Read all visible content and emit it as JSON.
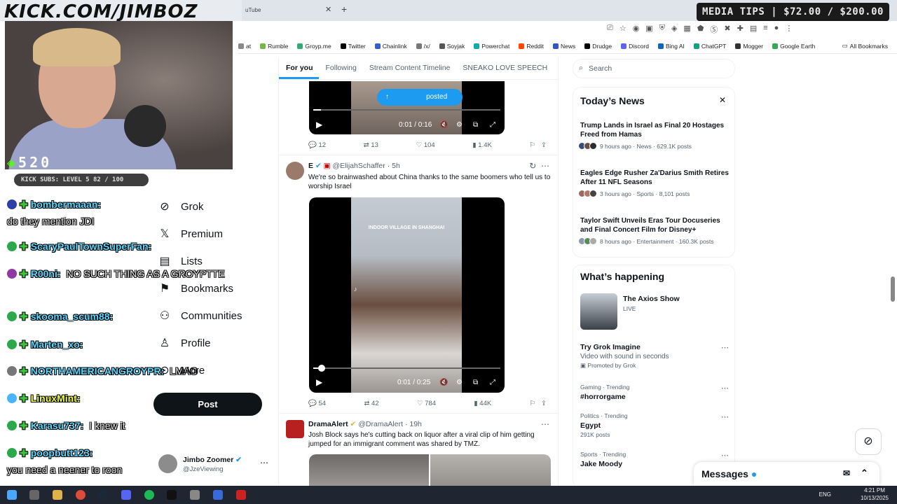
{
  "browser": {
    "tab_title": "uTube",
    "url_overlay": "KICK.COM/JIMBOZ",
    "media_tips": "MEDIA TIPS | $72.00 / $200.00",
    "bookmarks": [
      "at",
      "Rumble",
      "Groyp.me",
      "Twitter",
      "Chainlink",
      "/x/",
      "Soyjak",
      "Powerchat",
      "Reddit",
      "News",
      "Drudge",
      "Discord",
      "Bing AI",
      "ChatGPT",
      "Mogger",
      "Google Earth"
    ],
    "all_bookmarks": "All Bookmarks"
  },
  "stream": {
    "viewer_count": "520",
    "kick_subs": "KICK SUBS: LEVEL 5 82 / 100",
    "chat": [
      {
        "name": "bombermaaan:",
        "msg": "",
        "name_color": "#5ad7ff"
      },
      {
        "name": "",
        "msg": "do they mention JDI",
        "name_color": "#5ad7ff"
      },
      {
        "name": "ScaryPaulTownSuperFan:",
        "msg": "",
        "name_color": "#5ad7ff"
      },
      {
        "name": "R00ni:",
        "msg": "NO SUCH THING AS A GROYPTTE",
        "name_color": "#5ad7ff"
      },
      {
        "name": "skooma_scum88:",
        "msg": "",
        "name_color": "#5ad7ff"
      },
      {
        "name": "Marten_xo:",
        "msg": "",
        "name_color": "#5ad7ff"
      },
      {
        "name": "NORTHAMERICANGROYPR:",
        "msg": "LMAO",
        "name_color": "#5ad7ff"
      },
      {
        "name": "LinuxMint:",
        "msg": "",
        "name_color": "#f3ff4a"
      },
      {
        "name": "Karasu737:",
        "msg": "I knew it",
        "name_color": "#5ad7ff"
      },
      {
        "name": "poopbutt123:",
        "msg": "",
        "name_color": "#5ad7ff"
      },
      {
        "name": "",
        "msg": "you need a neener to roon",
        "name_color": "#5ad7ff"
      }
    ]
  },
  "nav": {
    "items": [
      "Grok",
      "Premium",
      "Lists",
      "Bookmarks",
      "Communities",
      "Profile",
      "More"
    ],
    "post": "Post",
    "account_name": "Jimbo Zoomer",
    "account_handle": "@JzeViewing"
  },
  "timeline": {
    "tabs": [
      "For you",
      "Following",
      "Stream Content Timeline",
      "SNEAKO LOVE SPEECH"
    ],
    "posted_pill": "posted",
    "video1_time": "0:01 / 0:16",
    "video1_progress": 0.04,
    "tweet1_stats": {
      "replies": "12",
      "reposts": "13",
      "likes": "104",
      "views": "1.4K"
    },
    "tweet2": {
      "name": "E",
      "handle": "@ElijahSchaffer",
      "time": "· 5h",
      "text": "We're so brainwashed about China thanks to the same boomers who tell us to worship Israel",
      "video_caption": "INDOOR VILLAGE IN SHANGHAI",
      "video_time": "0:01 / 0:25",
      "video_progress": 0.06,
      "stats": {
        "replies": "54",
        "reposts": "42",
        "likes": "784",
        "views": "44K"
      }
    },
    "tweet3": {
      "name": "DramaAlert",
      "handle": "@DramaAlert",
      "time": "· 19h",
      "text": "Josh Block says he's cutting back on liquor after a viral clip of him getting jumped for an immigrant comment was shared by TMZ."
    }
  },
  "right": {
    "search_placeholder": "Search",
    "todays_news_title": "Today’s News",
    "news": [
      {
        "headline": "Trump Lands in Israel as Final 20 Hostages Freed from Hamas",
        "meta": "9 hours ago · News · 629.1K posts"
      },
      {
        "headline": "Eagles Edge Rusher Za'Darius Smith Retires After 11 NFL Seasons",
        "meta": "3 hours ago · Sports · 8,101 posts"
      },
      {
        "headline": "Taylor Swift Unveils Eras Tour Docuseries and Final Concert Film for Disney+",
        "meta": "8 hours ago · Entertainment · 160.3K posts"
      }
    ],
    "happening_title": "What’s happening",
    "axios": {
      "title": "The Axios Show",
      "status": "LIVE"
    },
    "promo": {
      "title": "Try Grok Imagine",
      "sub": "Video with sound in seconds",
      "promoted": "Promoted by Grok"
    },
    "trends": [
      {
        "category": "Gaming · Trending",
        "topic": "#horrorgame",
        "posts": ""
      },
      {
        "category": "Politics · Trending",
        "topic": "Egypt",
        "posts": "291K posts"
      },
      {
        "category": "Sports · Trending",
        "topic": "Jake Moody",
        "posts": ""
      }
    ],
    "messages": "Messages"
  },
  "taskbar": {
    "lang": "ENG",
    "time": "4:21 PM",
    "date": "10/13/2025"
  }
}
